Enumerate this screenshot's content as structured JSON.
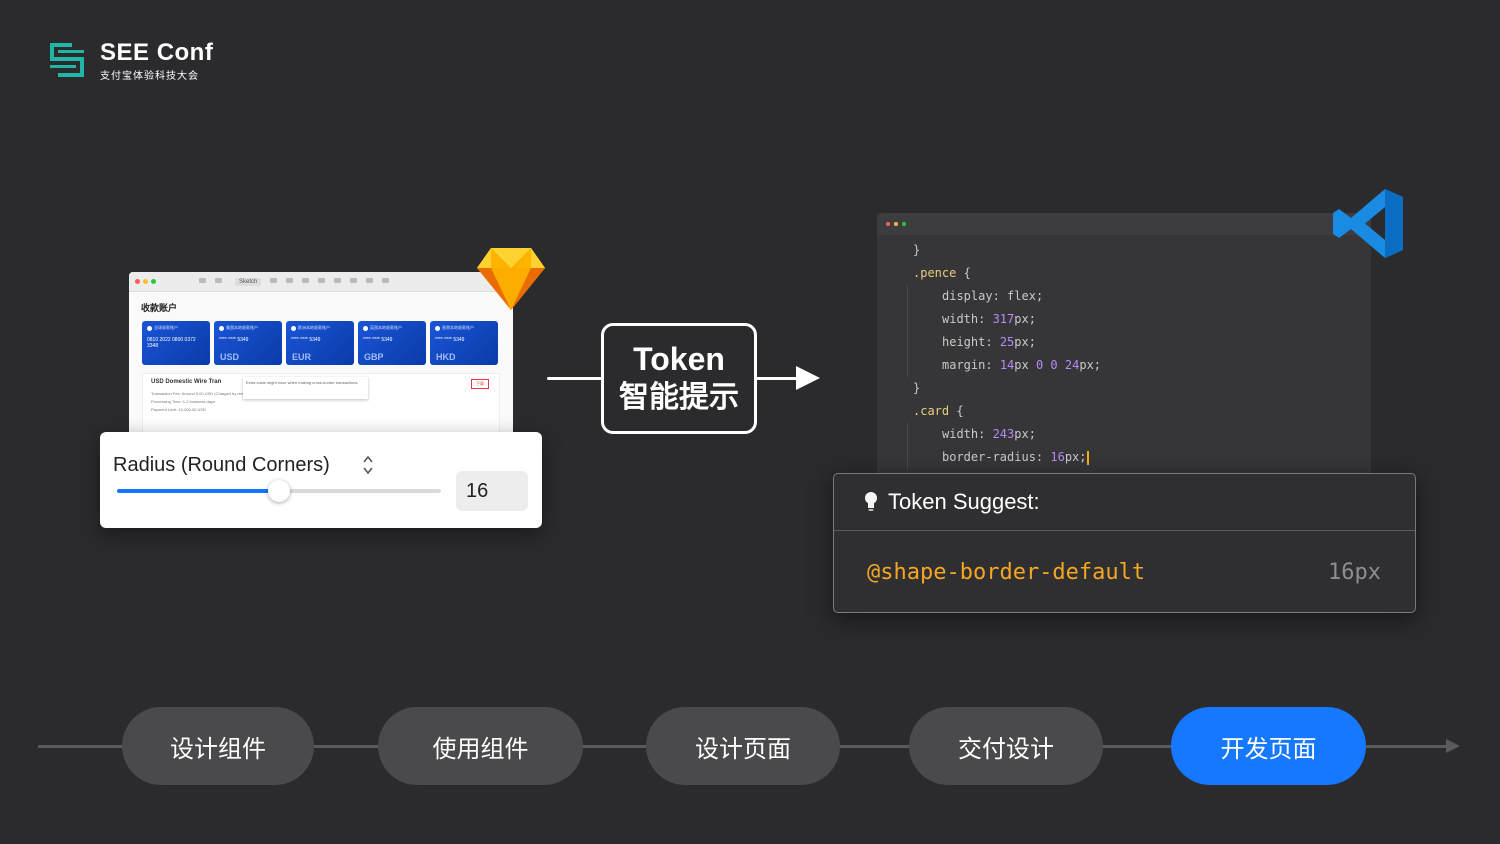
{
  "brand": {
    "name": "SEE Conf",
    "subtitle": "支付宝体验科技大会",
    "color": "#1fb6a8"
  },
  "sketch": {
    "toolbar_tab": "Sketch",
    "heading": "收款账户",
    "cards": [
      {
        "top": "全球收款账户",
        "number": "0810 2022 0800 0372 3348",
        "currency": ""
      },
      {
        "top": "美国本地收款账户",
        "number": "**** **** 5349",
        "currency": "USD"
      },
      {
        "top": "欧洲本地收款账户",
        "number": "**** **** 5349",
        "currency": "EUR"
      },
      {
        "top": "英国本地收款账户",
        "number": "**** **** 5349",
        "currency": "GBP"
      },
      {
        "top": "香港本地收款账户",
        "number": "**** **** 5349",
        "currency": "HKD"
      }
    ],
    "detail_title": "USD Domestic Wire Tran",
    "detail_tooltip": "Extra costs might incur when making cross-border transactions.",
    "detail_tag": "下载",
    "detail_lines": [
      "Transaction Fee: Around 5.00 USD (Charged by remitting bank)",
      "Processing Time: 1-2 business days",
      "Payment Limit: 10,000.00 USD"
    ]
  },
  "radius_panel": {
    "label": "Radius (Round Corners)",
    "value": "16",
    "slider_fraction": 0.5
  },
  "token_box": {
    "line1": "Token",
    "line2": "智能提示"
  },
  "code": {
    "lines": [
      {
        "indent": 0,
        "tokens": [
          {
            "t": "}",
            "c": "c-punct"
          }
        ]
      },
      {
        "indent": 0,
        "tokens": [
          {
            "t": ".pence",
            "c": "c-sel"
          },
          {
            "t": " {",
            "c": "c-punct"
          }
        ]
      },
      {
        "indent": 1,
        "tokens": [
          {
            "t": "display",
            "c": "c-prop"
          },
          {
            "t": ": ",
            "c": "c-punct"
          },
          {
            "t": "flex",
            "c": "c-kw"
          },
          {
            "t": ";",
            "c": "c-punct"
          }
        ]
      },
      {
        "indent": 1,
        "tokens": [
          {
            "t": "width",
            "c": "c-prop"
          },
          {
            "t": ": ",
            "c": "c-punct"
          },
          {
            "t": "317",
            "c": "c-num"
          },
          {
            "t": "px",
            "c": "c-val"
          },
          {
            "t": ";",
            "c": "c-punct"
          }
        ]
      },
      {
        "indent": 1,
        "tokens": [
          {
            "t": "height",
            "c": "c-prop"
          },
          {
            "t": ": ",
            "c": "c-punct"
          },
          {
            "t": "25",
            "c": "c-num"
          },
          {
            "t": "px",
            "c": "c-val"
          },
          {
            "t": ";",
            "c": "c-punct"
          }
        ]
      },
      {
        "indent": 1,
        "tokens": [
          {
            "t": "margin",
            "c": "c-prop"
          },
          {
            "t": ": ",
            "c": "c-punct"
          },
          {
            "t": "14",
            "c": "c-num"
          },
          {
            "t": "px ",
            "c": "c-val"
          },
          {
            "t": "0",
            "c": "c-num"
          },
          {
            "t": " ",
            "c": "c-val"
          },
          {
            "t": "0",
            "c": "c-num"
          },
          {
            "t": " ",
            "c": "c-val"
          },
          {
            "t": "24",
            "c": "c-num"
          },
          {
            "t": "px",
            "c": "c-val"
          },
          {
            "t": ";",
            "c": "c-punct"
          }
        ]
      },
      {
        "indent": 0,
        "tokens": [
          {
            "t": "}",
            "c": "c-punct"
          }
        ]
      },
      {
        "indent": 0,
        "tokens": [
          {
            "t": ".card",
            "c": "c-sel"
          },
          {
            "t": " {",
            "c": "c-punct"
          }
        ]
      },
      {
        "indent": 1,
        "tokens": [
          {
            "t": "width",
            "c": "c-prop"
          },
          {
            "t": ": ",
            "c": "c-punct"
          },
          {
            "t": "243",
            "c": "c-num"
          },
          {
            "t": "px",
            "c": "c-val"
          },
          {
            "t": ";",
            "c": "c-punct"
          }
        ]
      },
      {
        "indent": 1,
        "caret": true,
        "tokens": [
          {
            "t": "border-radius",
            "c": "c-prop"
          },
          {
            "t": ": ",
            "c": "c-punct"
          },
          {
            "t": "16",
            "c": "c-num"
          },
          {
            "t": "px",
            "c": "c-val"
          },
          {
            "t": ";",
            "c": "c-punct"
          }
        ]
      }
    ]
  },
  "suggest": {
    "title": "Token Suggest:",
    "token": "@shape-border-default",
    "value": "16px",
    "token_color": "#f5a623"
  },
  "timeline": {
    "steps": [
      {
        "label": "设计组件",
        "active": false
      },
      {
        "label": "使用组件",
        "active": false
      },
      {
        "label": "设计页面",
        "active": false
      },
      {
        "label": "交付设计",
        "active": false
      },
      {
        "label": "开发页面",
        "active": true
      }
    ],
    "active_color": "#1677ff"
  }
}
